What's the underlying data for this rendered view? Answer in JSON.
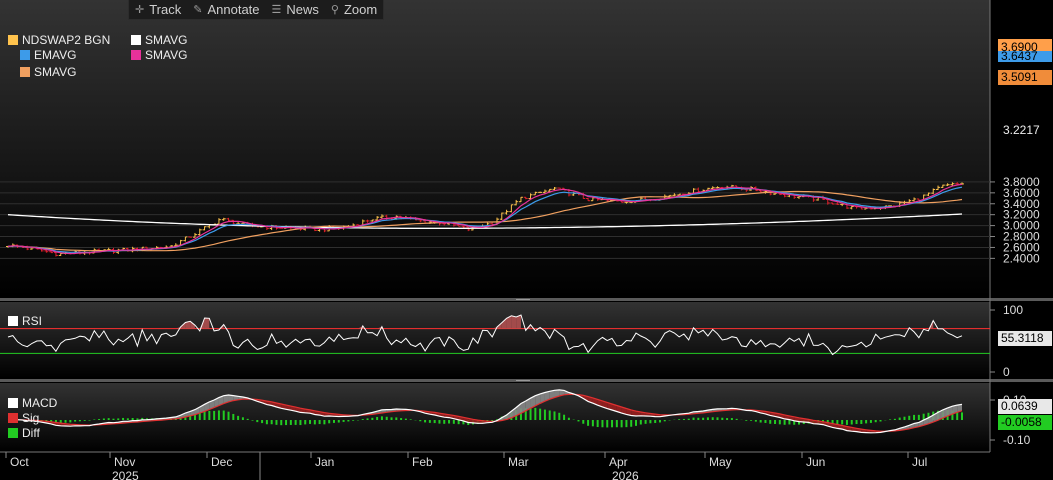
{
  "toolbar": {
    "track": "Track",
    "annotate": "Annotate",
    "news": "News",
    "zoom": "Zoom"
  },
  "legend_main": {
    "ticker": "NDSWAP2 BGN",
    "ema": "EMAVG",
    "sma1": "SMAVG",
    "sma2": "SMAVG",
    "sma3": "SMAVG"
  },
  "legend_rsi": {
    "rsi": "RSI"
  },
  "legend_macd": {
    "macd": "MACD",
    "sig": "Sig",
    "diff": "Diff"
  },
  "price_labels": {
    "last_pink": "3.6900",
    "ema_partial": "3.6437",
    "sma_orange": "3.5091",
    "sma_white": "3.2217",
    "rsi_value": "55.3118",
    "macd_value": "0.0639",
    "diff_value": "-0.0058"
  },
  "colors": {
    "bull": "#ffc34d",
    "bear": "#e0202a",
    "ema": "#3d9be9",
    "sma_pink": "#e8319a",
    "sma_orange": "#f0a060",
    "sma_white": "#ffffff",
    "rsi_upper": "#ff3030",
    "rsi_lower": "#22cc22",
    "macd_sig": "#e03030",
    "diff": "#22cc22"
  },
  "chart_data": [
    {
      "type": "candlestick",
      "title": "NDSWAP2 BGN",
      "x_axis": {
        "months": [
          "Oct",
          "Nov",
          "Dec",
          "Jan",
          "Feb",
          "Mar",
          "Apr",
          "May",
          "Jun",
          "Jul"
        ],
        "years": [
          "2025",
          "2026"
        ]
      },
      "y_axis": {
        "ticks": [
          "2.4000",
          "2.6000",
          "2.8000",
          "3.0000",
          "3.2000",
          "3.4000",
          "3.6000",
          "3.8000"
        ],
        "ylim": [
          2.3,
          3.88
        ]
      },
      "close_path": [
        [
          "Oct",
          2.6
        ],
        [
          "Oct",
          2.48
        ],
        [
          "Oct",
          2.52
        ],
        [
          "Nov",
          2.55
        ],
        [
          "Nov",
          2.58
        ],
        [
          "Nov",
          2.62
        ],
        [
          "Nov",
          2.85
        ],
        [
          "Dec",
          3.12
        ],
        [
          "Dec",
          3.0
        ],
        [
          "Dec",
          2.97
        ],
        [
          "Dec",
          2.95
        ],
        [
          "Jan",
          2.93
        ],
        [
          "Jan",
          2.98
        ],
        [
          "Jan",
          3.12
        ],
        [
          "Jan",
          3.17
        ],
        [
          "Feb",
          3.08
        ],
        [
          "Feb",
          3.05
        ],
        [
          "Feb",
          2.93
        ],
        [
          "Feb",
          3.05
        ],
        [
          "Mar",
          3.5
        ],
        [
          "Mar",
          3.68
        ],
        [
          "Mar",
          3.48
        ],
        [
          "Apr",
          3.44
        ],
        [
          "Apr",
          3.5
        ],
        [
          "Apr",
          3.62
        ],
        [
          "May",
          3.72
        ],
        [
          "May",
          3.66
        ],
        [
          "May",
          3.56
        ],
        [
          "Jun",
          3.48
        ],
        [
          "Jun",
          3.31
        ],
        [
          "Jun",
          3.35
        ],
        [
          "Jul",
          3.5
        ],
        [
          "Jul",
          3.72
        ],
        [
          "Jul",
          3.78
        ],
        [
          "Jul",
          3.69
        ]
      ],
      "series": [
        {
          "name": "EMAVG",
          "last": 3.6437
        },
        {
          "name": "SMAVG",
          "last": 3.69
        },
        {
          "name": "SMAVG",
          "last": 3.5091
        },
        {
          "name": "SMAVG",
          "last": 3.2217
        }
      ]
    },
    {
      "type": "line",
      "title": "RSI",
      "y_axis": {
        "ticks": [
          "0",
          "100"
        ],
        "ylim": [
          0,
          100
        ]
      },
      "levels": [
        70,
        30
      ],
      "series": [
        {
          "name": "RSI",
          "last": 55.3118
        }
      ]
    },
    {
      "type": "line",
      "title": "MACD",
      "y_axis": {
        "ticks": [
          "0.10",
          "-0.10"
        ]
      },
      "series": [
        {
          "name": "MACD",
          "last": 0.0639
        },
        {
          "name": "Sig"
        },
        {
          "name": "Diff",
          "last": -0.0058
        }
      ]
    }
  ]
}
